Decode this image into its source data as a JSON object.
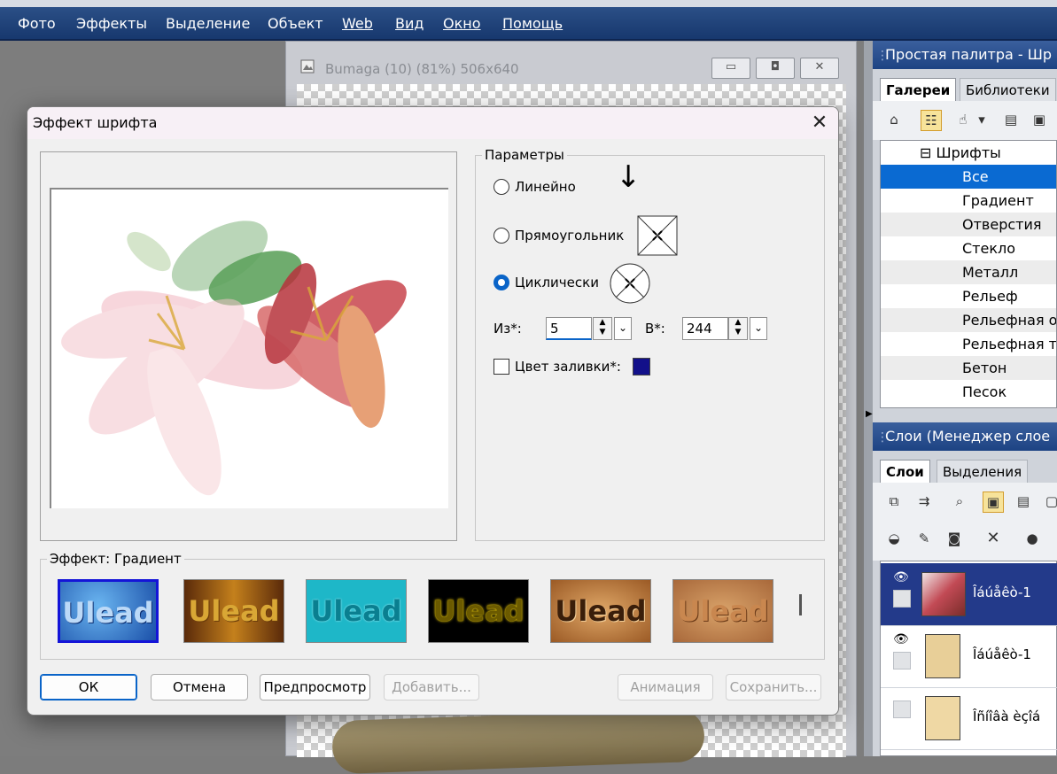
{
  "menubar": {
    "items": [
      "Фото",
      "Эффекты",
      "Выделение",
      "Объект",
      "Web",
      "Вид",
      "Окно",
      "Помощь"
    ]
  },
  "document": {
    "title": "Bumaga (10) (81%) 506x640",
    "minimize": "▭",
    "restore": "◘",
    "close": "✕"
  },
  "gallery_panel": {
    "title": "Простая палитра - Шр",
    "tabs": [
      "Галереи",
      "Библиотеки"
    ],
    "root": "⊟ Шрифты",
    "items": [
      "Все",
      "Градиент",
      "Отверстия",
      "Стекло",
      "Металл",
      "Рельеф",
      "Рельефная об",
      "Рельефная те",
      "Бетон",
      "Песок"
    ],
    "selected_index": 0
  },
  "layers_panel": {
    "title": "Слои (Менеджер слое",
    "tabs": [
      "Слои",
      "Выделения"
    ],
    "layers": [
      {
        "name": "Îáúåêò-1",
        "selected": true
      },
      {
        "name": "Îáúåêò-1",
        "selected": false
      },
      {
        "name": "Îñíîâà èçîá",
        "selected": false
      }
    ]
  },
  "dialog": {
    "title": "Эффект шрифта",
    "close": "✕",
    "params_label": "Параметры",
    "radio_linear": "Линейно",
    "radio_rect": "Прямоугольник",
    "radio_cyclic": "Циклически",
    "selected_mode": "cyclic",
    "arrow": "↓",
    "from_label": "Из*:",
    "from_value": "5",
    "to_label": "В*:",
    "to_value": "244",
    "fill_label": "Цвет заливки*:",
    "fill_color": "#12108a",
    "effect_label": "Эффект: Градиент",
    "presets": [
      {
        "text": "Ulead",
        "name": "blue-water-preset",
        "selected": true
      },
      {
        "text": "Ulead",
        "name": "gold-brown-preset",
        "selected": false
      },
      {
        "text": "Ulead",
        "name": "cyan-outline-preset",
        "selected": false
      },
      {
        "text": "Ulead",
        "name": "yellow-neon-preset",
        "selected": false
      },
      {
        "text": "Ulead",
        "name": "wood-relief-preset",
        "selected": false
      },
      {
        "text": "Ulead",
        "name": "sand-stone-preset",
        "selected": false
      }
    ],
    "buttons": {
      "ok": "ОК",
      "cancel": "Отмена",
      "preview": "Предпросмотр",
      "add": "Добавить...",
      "animation": "Анимация",
      "save": "Сохранить..."
    }
  },
  "colors": {
    "menubar": "#1f417a",
    "selection": "#0a6ad2",
    "layer_selected": "#233a8a"
  }
}
